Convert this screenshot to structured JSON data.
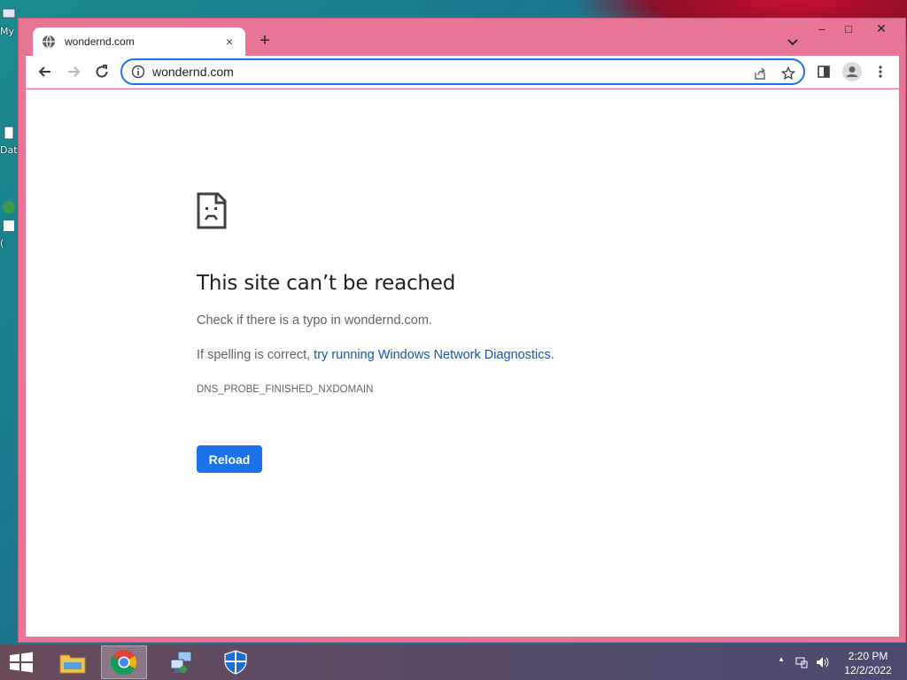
{
  "desktop": {
    "icon_labels": [
      "My",
      "Dat",
      "",
      "("
    ]
  },
  "browser": {
    "tab_title": "wondernd.com",
    "tab_close": "×",
    "new_tab": "+",
    "address": "wondernd.com",
    "window_controls": {
      "minimize": "–",
      "maximize": "□",
      "close": "✕"
    }
  },
  "error_page": {
    "headline": "This site can’t be reached",
    "line1": "Check if there is a typo in wondernd.com.",
    "line2_prefix": "If spelling is correct, ",
    "line2_link": "try running Windows Network Diagnostics",
    "line2_suffix": ".",
    "error_code": "DNS_PROBE_FINISHED_NXDOMAIN",
    "reload_label": "Reload"
  },
  "taskbar": {
    "time": "2:20 PM",
    "date": "12/2/2022",
    "tray_up_arrow": "▲"
  },
  "colors": {
    "window_frame": "#e87596",
    "accent_blue": "#1a73e8",
    "link_blue": "#1a56a8"
  }
}
